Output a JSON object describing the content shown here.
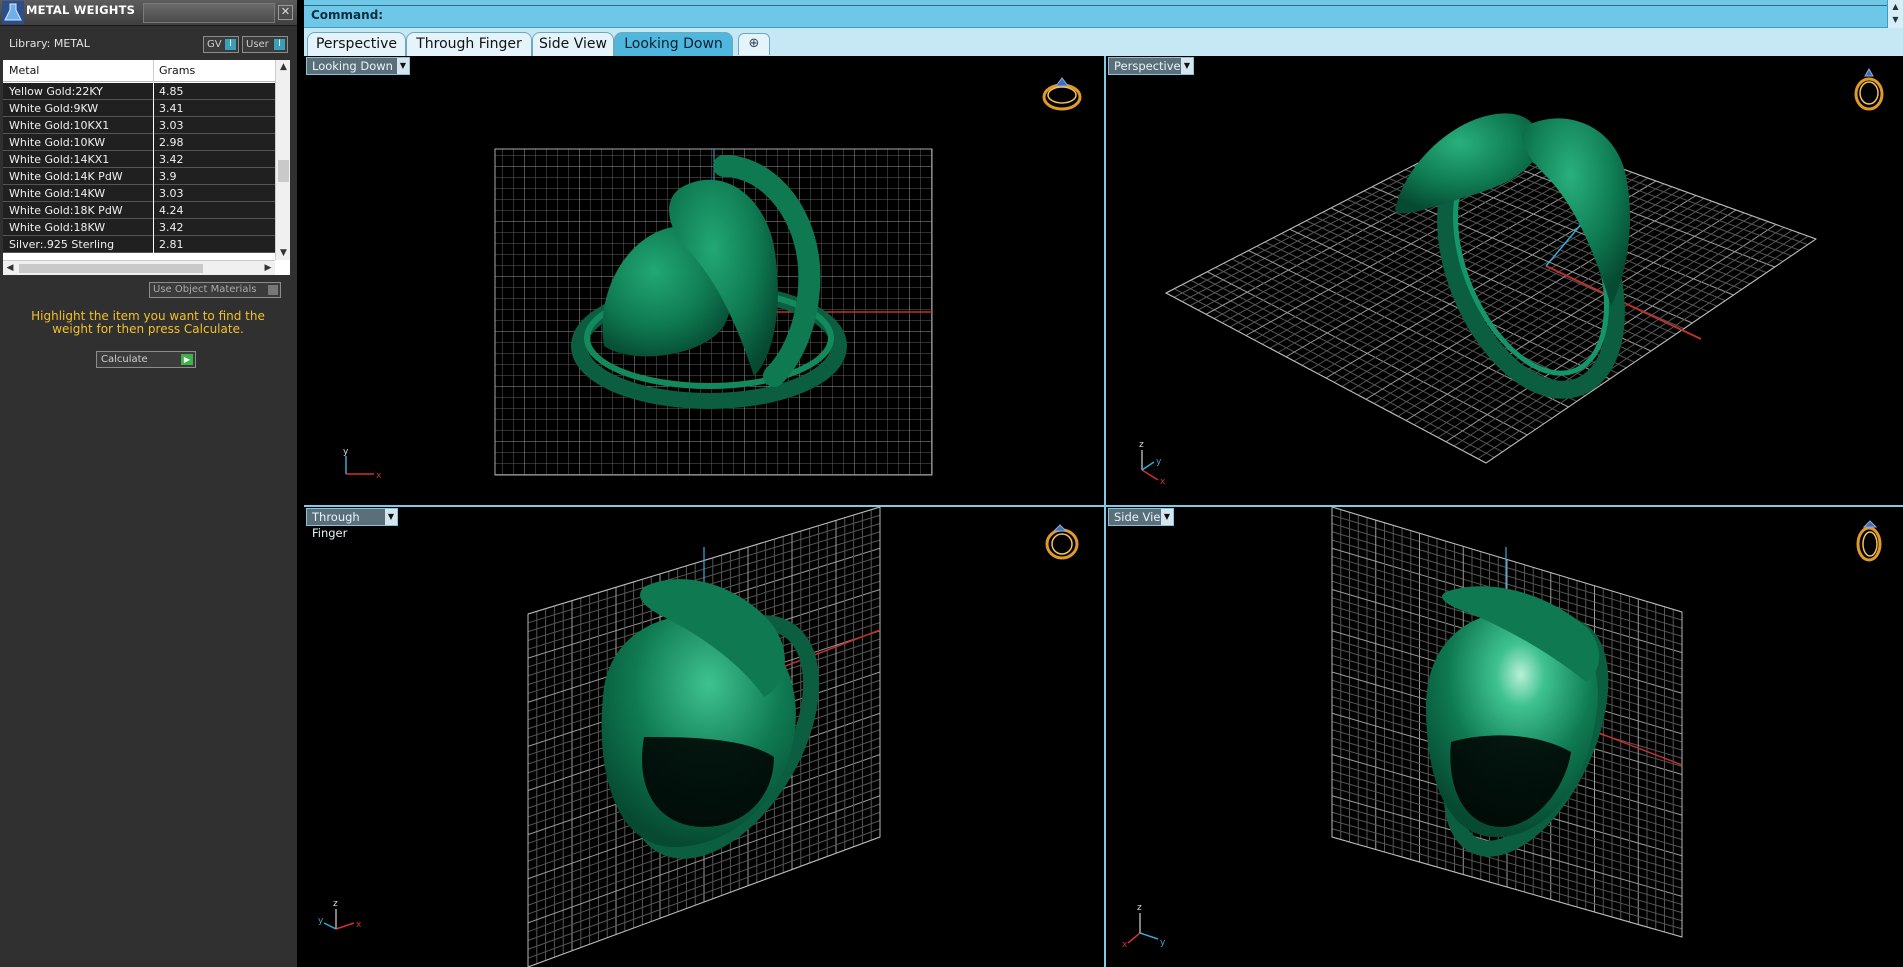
{
  "panel": {
    "title": "METAL WEIGHTS",
    "library_label": "Library: METAL",
    "gv_button": "GV",
    "user_button": "User",
    "indicator": "I",
    "columns": [
      "Metal",
      "Grams"
    ],
    "rows": [
      {
        "metal": "Yellow Gold:22KY",
        "grams": "4.85"
      },
      {
        "metal": "White Gold:9KW",
        "grams": "3.41"
      },
      {
        "metal": "White Gold:10KX1",
        "grams": "3.03"
      },
      {
        "metal": "White Gold:10KW",
        "grams": "2.98"
      },
      {
        "metal": "White Gold:14KX1",
        "grams": "3.42"
      },
      {
        "metal": "White Gold:14K PdW",
        "grams": "3.9"
      },
      {
        "metal": "White Gold:14KW",
        "grams": "3.03"
      },
      {
        "metal": "White Gold:18K PdW",
        "grams": "4.24"
      },
      {
        "metal": "White Gold:18KW",
        "grams": "3.42"
      },
      {
        "metal": "Silver:.925 Sterling",
        "grams": "2.81"
      }
    ],
    "use_object_materials": "Use Object Materials",
    "hint": "Highlight the item you want to find the weight for then press Calculate.",
    "calculate_button": "Calculate"
  },
  "command": {
    "label": "Command:"
  },
  "tabs": [
    {
      "label": "Perspective",
      "active": false
    },
    {
      "label": "Through Finger",
      "active": false
    },
    {
      "label": "Side View",
      "active": false
    },
    {
      "label": "Looking Down",
      "active": true
    }
  ],
  "viewports": {
    "top_left": {
      "label": "Looking Down"
    },
    "top_right": {
      "label": "Perspective"
    },
    "bottom_left": {
      "label": "Through Finger"
    },
    "bottom_right": {
      "label": "Side View"
    }
  },
  "axis_letters": {
    "x": "x",
    "y": "y",
    "z": "z"
  },
  "colors": {
    "ring_green": "#0f7a52",
    "grid": "#6f6f6f",
    "accent_blue": "#6ec7e6",
    "hint_yellow": "#f2c02a"
  }
}
